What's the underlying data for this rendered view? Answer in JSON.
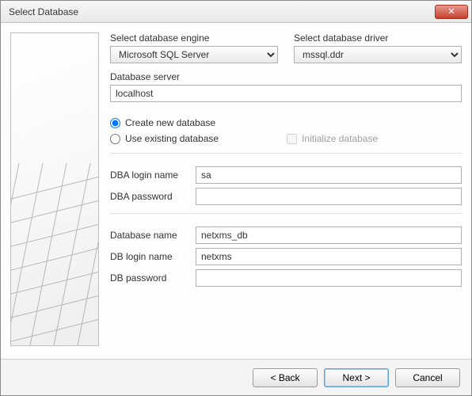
{
  "window": {
    "title": "Select Database"
  },
  "labels": {
    "engine": "Select database engine",
    "driver": "Select database driver",
    "server": "Database server",
    "create_new": "Create new database",
    "use_existing": "Use existing database",
    "init_db": "Initialize database",
    "dba_login": "DBA login name",
    "dba_password": "DBA password",
    "db_name": "Database name",
    "db_login": "DB login name",
    "db_password": "DB password"
  },
  "values": {
    "engine": "Microsoft SQL Server",
    "driver": "mssql.ddr",
    "server": "localhost",
    "db_mode": "create",
    "init_checked": false,
    "dba_login": "sa",
    "dba_password": "",
    "db_name": "netxms_db",
    "db_login": "netxms",
    "db_password": ""
  },
  "buttons": {
    "back": "< Back",
    "next": "Next >",
    "cancel": "Cancel"
  }
}
